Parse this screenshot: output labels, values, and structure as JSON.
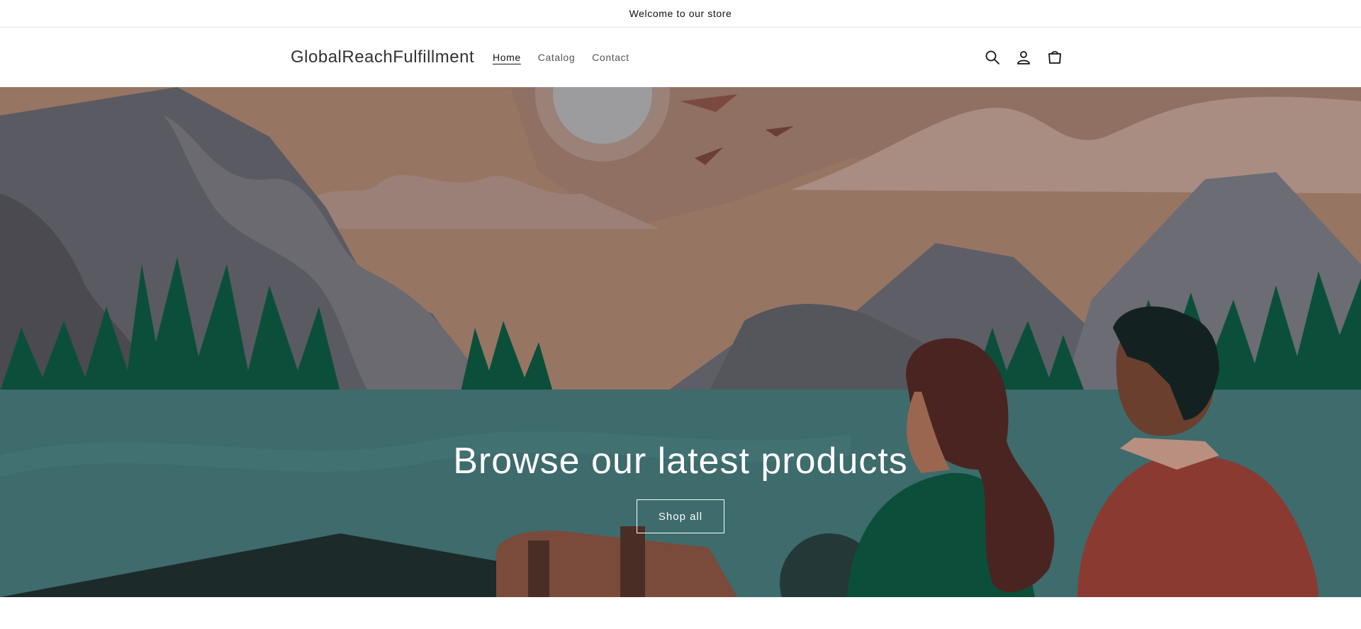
{
  "announcement": {
    "text": "Welcome to our store"
  },
  "header": {
    "logo": "GlobalReachFulfillment",
    "nav": [
      {
        "label": "Home",
        "active": true
      },
      {
        "label": "Catalog",
        "active": false
      },
      {
        "label": "Contact",
        "active": false
      }
    ],
    "icons": [
      "search-icon",
      "account-icon",
      "cart-icon"
    ]
  },
  "hero": {
    "title": "Browse our latest products",
    "button_label": "Shop all"
  },
  "colors": {
    "sky": "#8f7062",
    "water": "#3e6b6b",
    "trees": "#0b4f3a",
    "mountains": "#5a5a62"
  }
}
